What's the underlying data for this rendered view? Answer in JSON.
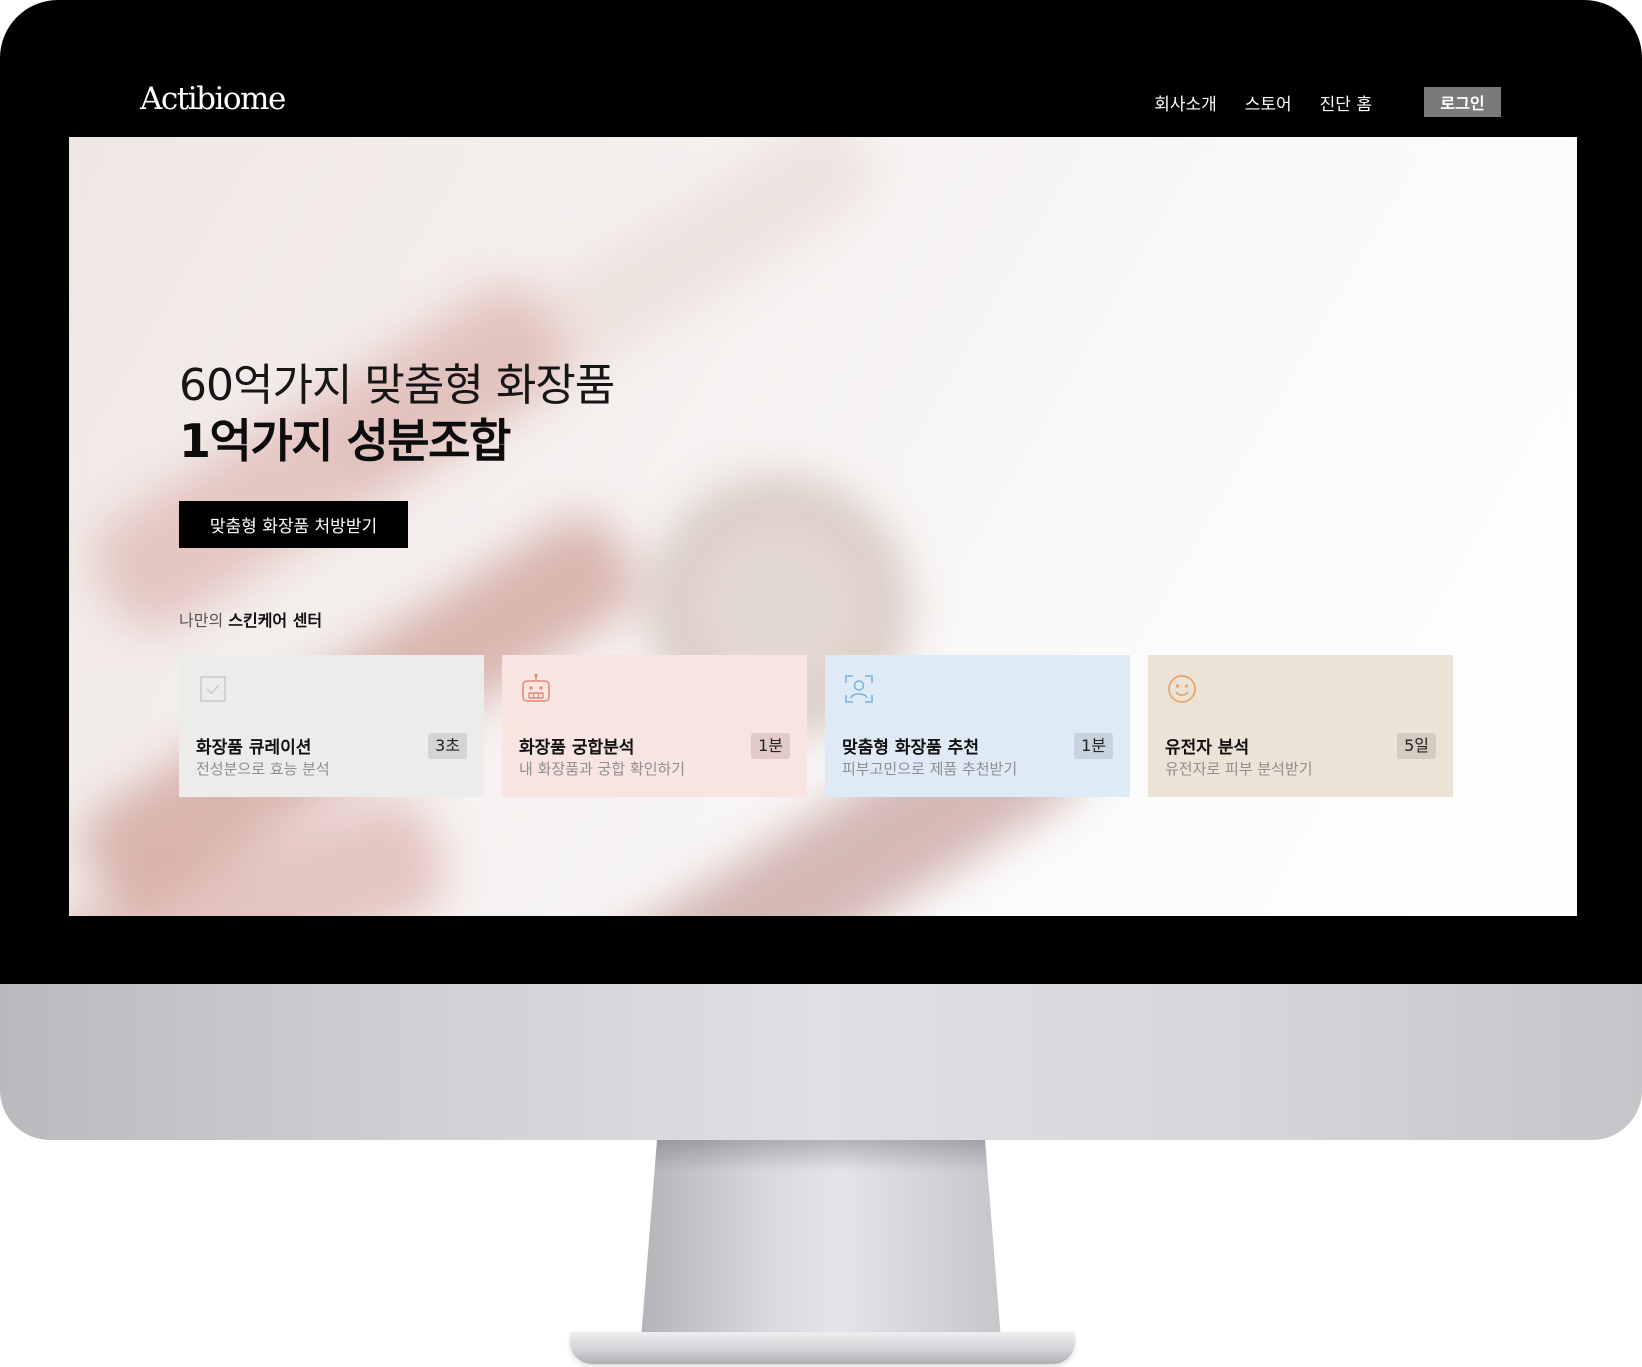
{
  "nav": {
    "logo": "Actibiome",
    "links": [
      "회사소개",
      "스토어",
      "진단 홈"
    ],
    "login_label": "로그인"
  },
  "hero": {
    "headline_line1": "60억가지 맞춤형 화장품",
    "headline_line2": "1억가지 성분조합",
    "cta_label": "맞춤형 화장품 처방받기",
    "section_label_muted": "나만의",
    "section_label_strong": "스킨케어 센터"
  },
  "cards": [
    {
      "title": "화장품 큐레이션",
      "subtitle": "전성분으로 효능 분석",
      "badge": "3초",
      "icon": "checkbox-icon",
      "bg": "#ececeb",
      "badge_bg": "#d4d4d4"
    },
    {
      "title": "화장품 궁합분석",
      "subtitle": "내 화장품과 궁합 확인하기",
      "badge": "1분",
      "icon": "robot-icon",
      "bg": "#f8e4e0",
      "badge_bg": "#e2cbc7"
    },
    {
      "title": "맞춤형 화장품 추천",
      "subtitle": "피부고민으로 제품 추천받기",
      "badge": "1분",
      "icon": "face-scan-icon",
      "bg": "#deebf6",
      "badge_bg": "#c7d3de"
    },
    {
      "title": "유전자 분석",
      "subtitle": "유전자로 피부 분석받기",
      "badge": "5일",
      "icon": "smiley-icon",
      "bg": "#ece2d6",
      "badge_bg": "#d5cbc0"
    }
  ]
}
